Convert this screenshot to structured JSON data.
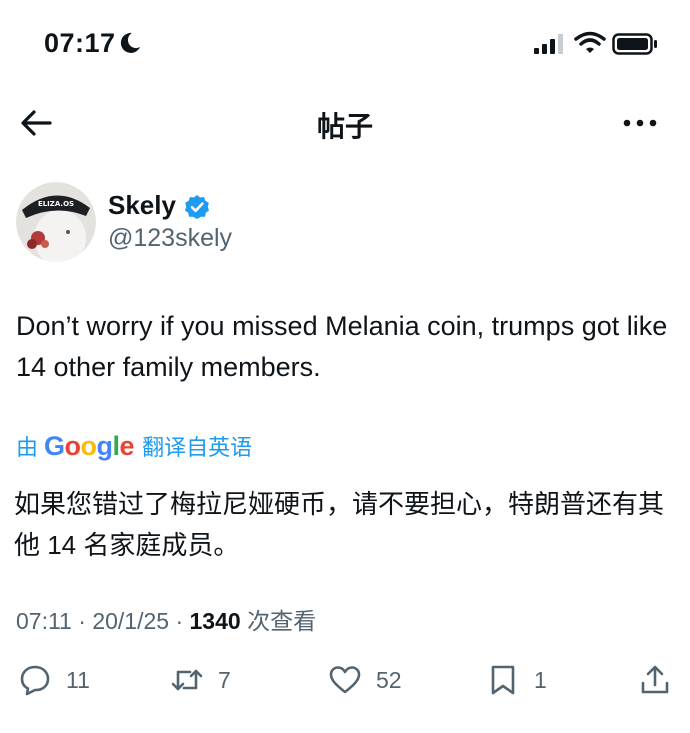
{
  "status_bar": {
    "time": "07:17"
  },
  "nav": {
    "title": "帖子"
  },
  "author": {
    "display_name": "Skely",
    "handle": "@123skely",
    "avatar_cap_text": "ELIZA.OS"
  },
  "tweet": {
    "text": "Don’t worry if you missed Melania coin, trumps got like 14 other family members.",
    "translate_prefix": "由",
    "translate_brand": "Google",
    "translate_suffix": "翻译自英语",
    "translated_text": "如果您错过了梅拉尼娅硬币，请不要担心，特朗普还有其他 14 名家庭成员。"
  },
  "meta": {
    "time": "07:11",
    "separator": "·",
    "date": "20/1/25",
    "views_count": "1340",
    "views_label": "次查看"
  },
  "actions": {
    "replies": "11",
    "reposts": "7",
    "likes": "52",
    "bookmarks": "1"
  },
  "colors": {
    "accent": "#1d9bf0",
    "muted": "#536471",
    "text": "#0f1419"
  }
}
